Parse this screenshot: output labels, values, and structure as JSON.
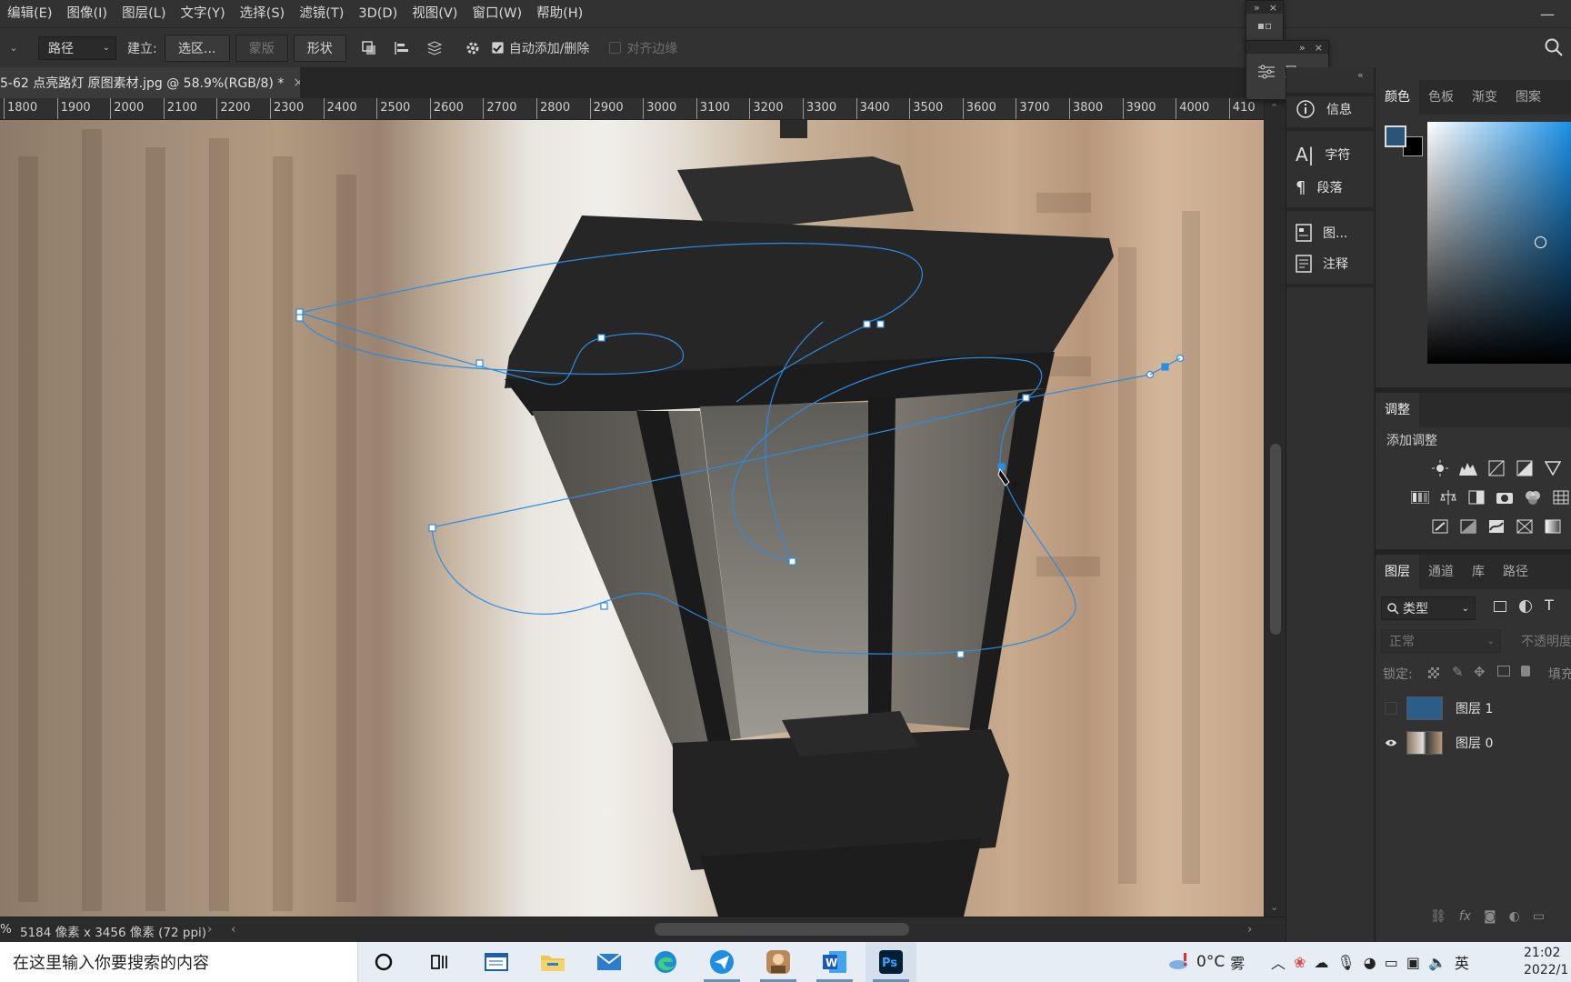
{
  "menu": {
    "items": [
      "编辑(E)",
      "图像(I)",
      "图层(L)",
      "文字(Y)",
      "选择(S)",
      "滤镜(T)",
      "3D(D)",
      "视图(V)",
      "窗口(W)",
      "帮助(H)"
    ],
    "window_minimize": "—"
  },
  "options": {
    "mode_value": "路径",
    "make_label": "建立:",
    "selection_btn": "选区...",
    "mask_btn": "蒙版",
    "shape_btn": "形状",
    "auto_add_delete": "自动添加/删除",
    "align_edges": "对齐边缘",
    "auto_add_checked": true,
    "align_edges_checked": false
  },
  "document": {
    "tab_title": "5-62 点亮路灯 原图素材.jpg @ 58.9%(RGB/8) *",
    "close": "×",
    "ruler_ticks": [
      "1800",
      "1900",
      "2000",
      "2100",
      "2200",
      "2300",
      "2400",
      "2500",
      "2600",
      "2700",
      "2800",
      "2900",
      "3000",
      "3100",
      "3200",
      "3300",
      "3400",
      "3500",
      "3600",
      "3700",
      "3800",
      "3900",
      "4000",
      "410"
    ]
  },
  "status": {
    "zoom_tail": "%",
    "dimensions": "5184 像素 x 3456 像素 (72 ppi)"
  },
  "float_panels": {
    "properties_label": "属..."
  },
  "dock": {
    "info": "信息",
    "character": "字符",
    "paragraph": "段落",
    "image": "图...",
    "notes": "注释"
  },
  "color_panel": {
    "tabs": [
      "颜色",
      "色板",
      "渐变",
      "图案"
    ],
    "foreground": "#2a5578",
    "background": "#000000"
  },
  "adjustments": {
    "title": "调整",
    "add_label": "添加调整"
  },
  "layers_panel": {
    "tabs": [
      "图层",
      "通道",
      "库",
      "路径"
    ],
    "filter": "类型",
    "blend_mode": "正常",
    "opacity_label": "不透明度",
    "lock_label": "锁定:",
    "fill_label": "填充",
    "layers": [
      {
        "name": "图层 1",
        "visible": false,
        "thumb_color": "#2c5d8a"
      },
      {
        "name": "图层 0",
        "visible": true,
        "thumb_color": "#8a7562"
      }
    ]
  },
  "taskbar": {
    "search_placeholder": "在这里输入你要搜索的内容",
    "weather_temp": "0°C",
    "weather_text": "雾",
    "ime": "英",
    "time": "21:02",
    "date": "2022/1"
  }
}
